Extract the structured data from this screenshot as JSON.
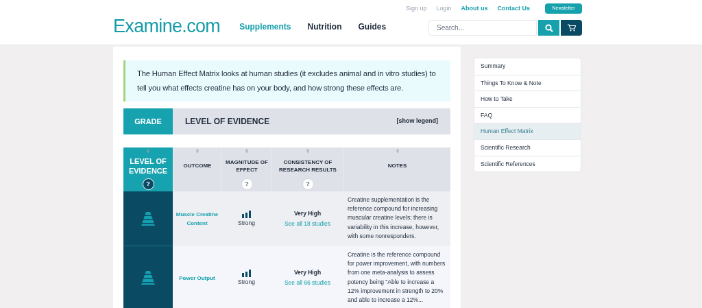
{
  "header": {
    "logo": "Examine.com",
    "nav": [
      {
        "label": "Supplements",
        "selected": true
      },
      {
        "label": "Nutrition",
        "selected": false
      },
      {
        "label": "Guides",
        "selected": false
      }
    ],
    "top_links": [
      {
        "label": "Sign up",
        "kind": "muted"
      },
      {
        "label": "Login",
        "kind": "muted"
      },
      {
        "label": "About us",
        "kind": "accent"
      },
      {
        "label": "Contact Us",
        "kind": "accent"
      }
    ],
    "newsletter": "Newsletter",
    "search": {
      "placeholder": "Search..."
    }
  },
  "intro": "The Human Effect Matrix looks at human studies (it excludes animal and in vitro studies) to tell you what effects creatine has on your body, and how strong these effects are.",
  "grade_bar": {
    "grade": "GRADE",
    "title": "LEVEL OF EVIDENCE",
    "legend": "[show legend]"
  },
  "table": {
    "columns": [
      {
        "label": "LEVEL OF EVIDENCE",
        "help": "?"
      },
      {
        "label": "OUTCOME"
      },
      {
        "label": "MAGNITUDE OF EFFECT",
        "help": "?"
      },
      {
        "label": "CONSISTENCY OF RESEARCH RESULTS",
        "help": "?"
      },
      {
        "label": "NOTES"
      }
    ],
    "rows": [
      {
        "outcome": "Muscle Creatine Content",
        "magnitude": "Strong",
        "consistency": "Very High",
        "studies": "See all 18 studies",
        "notes": "Creatine supplementation is the reference compound for increasing muscular creatine levels; there is variability in this increase, however, with some nonresponders."
      },
      {
        "outcome": "Power Output",
        "magnitude": "Strong",
        "consistency": "Very High",
        "studies": "See all 66 studies",
        "notes": "Creatine is the reference compound for power improvement, with numbers from one meta-analysis to assess potency being \"Able to increase a 12% improvement in strength to 20% and able to increase a 12%..."
      }
    ]
  },
  "sidebar": {
    "items": [
      {
        "label": "Summary",
        "selected": false
      },
      {
        "label": "Things To Know & Note",
        "selected": false
      },
      {
        "label": "How to Take",
        "selected": false
      },
      {
        "label": "FAQ",
        "selected": false
      },
      {
        "label": "Human Effect Matrix",
        "selected": true
      },
      {
        "label": "Scientific Research",
        "selected": false
      },
      {
        "label": "Scientific References",
        "selected": false
      }
    ]
  }
}
